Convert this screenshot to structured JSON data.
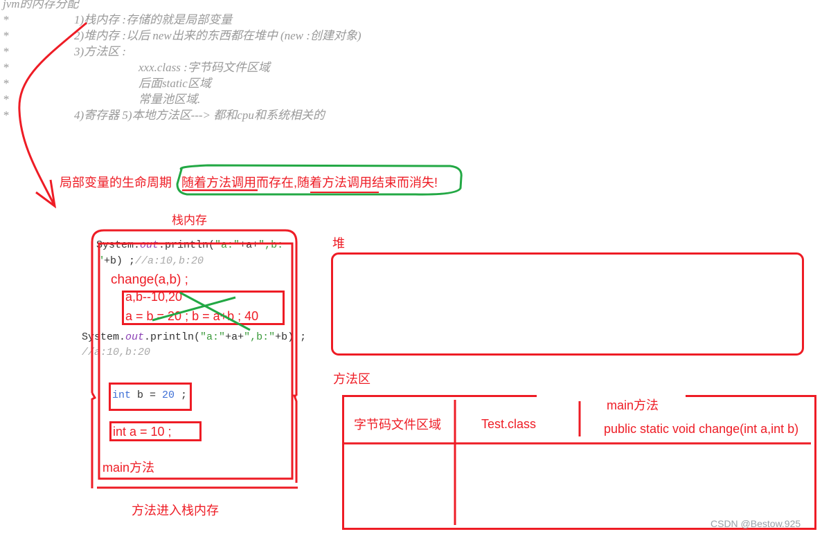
{
  "notes": {
    "title": "jvm的内存分配",
    "bullet": "*",
    "lines": [
      "1)栈内存 :存储的就是局部变量",
      "2)堆内存 :以后 new出来的东西都在堆中  (new :创建对象)",
      "3)方法区 :",
      "xxx.class :字节码文件区域",
      "后面static区域",
      "常量池区域.",
      "4)寄存器    5)本地方法区--->      都和cpu和系统相关的"
    ]
  },
  "lifecycle": {
    "label": "局部变量的生命周期",
    "highlight": "随着方法调用而存在,随着方法调用结束而消失!"
  },
  "stack": {
    "title": "栈内存",
    "print1_part1": "System.",
    "print1_field": "out",
    "print1_part2": ".println(",
    "print1_str1": "\"a:\"",
    "print1_plus1": "+a+",
    "print1_str2": "\",b:",
    "print1_line2_str": "\"",
    "print1_line2_rest": "+b) ;",
    "print1_comment": "//a:10,b:20",
    "change_call": "change(a,b) ;",
    "frame_line1": "a,b--10,20",
    "frame_line2": "a = b  = 20 ; b = a+b ; 40",
    "print2_part1": "System.",
    "print2_field": "out",
    "print2_part2": ".println(",
    "print2_str1": "\"a:\"",
    "print2_plus": "+a+",
    "print2_str2": "\",b:\"",
    "print2_rest": "+b)  ;",
    "print2_comment": "//a:10,b:20",
    "int_b_kw": "int",
    "int_b_mid": " b = ",
    "int_b_num": "20",
    "int_b_end": " ;",
    "int_a": "int a = 10 ;",
    "main_label": "main方法",
    "caption": "方法进入栈内存"
  },
  "heap": {
    "title": "堆"
  },
  "method_area": {
    "title": "方法区",
    "col1": "字节码文件区域",
    "col2": "Test.class",
    "col3_title": "main方法",
    "col3_sig": "public static  void change(int a,int b)"
  },
  "watermark": "CSDN @Bestow.925",
  "colors": {
    "annotation_red": "#ee1c25",
    "annotation_green": "#22a844",
    "comment_gray": "#9a9a9a"
  }
}
